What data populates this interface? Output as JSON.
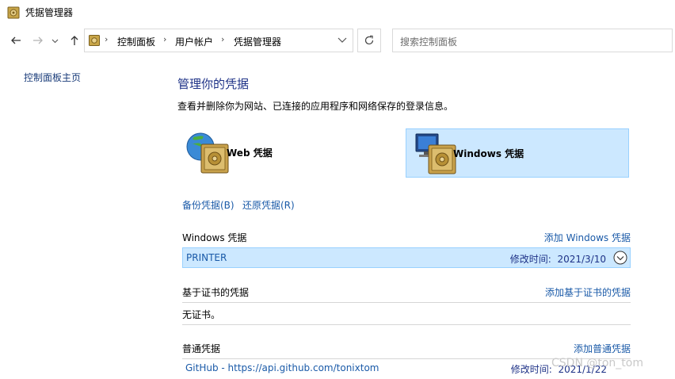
{
  "window": {
    "title": "凭据管理器"
  },
  "nav": {
    "back_icon": "arrow-left",
    "forward_icon": "arrow-right",
    "recent_icon": "chevron-down",
    "up_icon": "arrow-up",
    "breadcrumbs": [
      "控制面板",
      "用户帐户",
      "凭据管理器"
    ],
    "refresh_icon": "refresh",
    "search_placeholder": "搜索控制面板"
  },
  "sidebar": {
    "home_link": "控制面板主页"
  },
  "main": {
    "title": "管理你的凭据",
    "description": "查看并删除你为网站、已连接的应用程序和网络保存的登录信息。",
    "vaults": [
      {
        "label": "Web 凭据",
        "selected": false
      },
      {
        "label": "Windows 凭据",
        "selected": true
      }
    ],
    "backup_link": "备份凭据(B)",
    "restore_link": "还原凭据(R)",
    "sections": {
      "windows": {
        "title": "Windows 凭据",
        "action": "添加 Windows 凭据",
        "items": [
          {
            "name": "PRINTER",
            "modified_label": "修改时间:",
            "modified_date": "2021/3/10"
          }
        ]
      },
      "certificate": {
        "title": "基于证书的凭据",
        "action": "添加基于证书的凭据",
        "empty_text": "无证书。"
      },
      "generic": {
        "title": "普通凭据",
        "action": "添加普通凭据",
        "items": [
          {
            "name": "GitHub - https://api.github.com/tonixtom",
            "modified_label": "修改时间:",
            "modified_date": "2021/1/22"
          }
        ]
      }
    }
  },
  "watermark": "CSDN @ton_tom",
  "colors": {
    "selection_bg": "#cce8ff",
    "selection_border": "#99d1ff",
    "link": "#1a5aa8",
    "title": "#1e3287"
  }
}
